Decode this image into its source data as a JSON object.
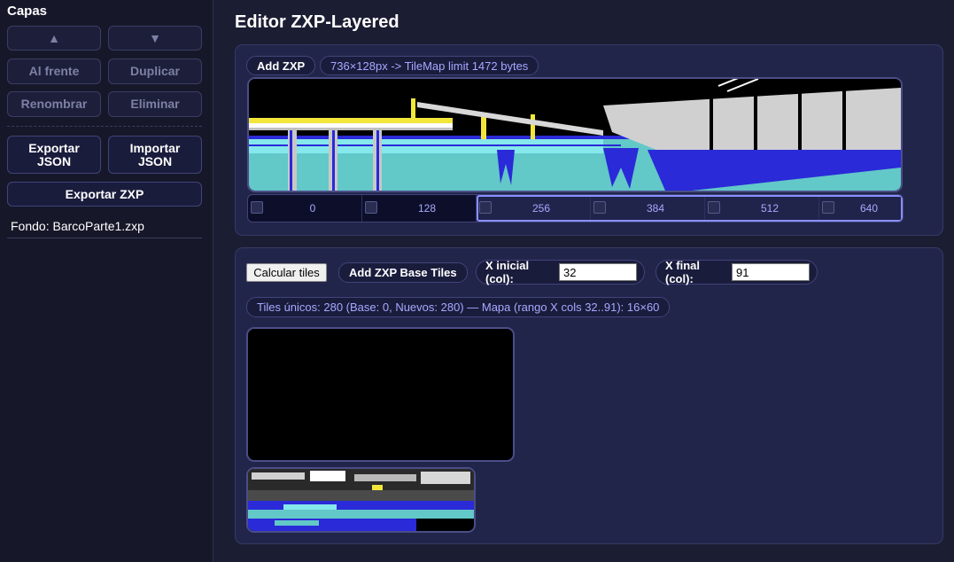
{
  "sidebar": {
    "title": "Capas",
    "move_up": "▲",
    "move_down": "▼",
    "to_front": "Al frente",
    "duplicate": "Duplicar",
    "rename": "Renombrar",
    "delete": "Eliminar",
    "export_json": "Exportar JSON",
    "import_json": "Importar JSON",
    "export_zxp": "Exportar ZXP",
    "background_label": "Fondo: BarcoParte1.zxp"
  },
  "main": {
    "title": "Editor ZXP-Layered",
    "add_zxp": "Add ZXP",
    "size_info": "736×128px -> TileMap limit 1472 bytes",
    "chunks": [
      "0",
      "128",
      "256",
      "384",
      "512",
      "640"
    ]
  },
  "tiles": {
    "calc_button": "Calcular tiles",
    "add_base": "Add ZXP Base Tiles",
    "x_start_label": "X inicial (col):",
    "x_start_value": "32",
    "x_end_label": "X final (col):",
    "x_end_value": "91",
    "summary": "Tiles únicos: 280 (Base: 0, Nuevos: 280) — Mapa (rango X cols 32..91): 16×60"
  },
  "colors": {
    "accent": "#a5a9ff",
    "sky": "#000000",
    "water": "#62c8c8",
    "water_light": "#85e8ec",
    "blue": "#2a2ad8",
    "yellow": "#f2e63a"
  }
}
